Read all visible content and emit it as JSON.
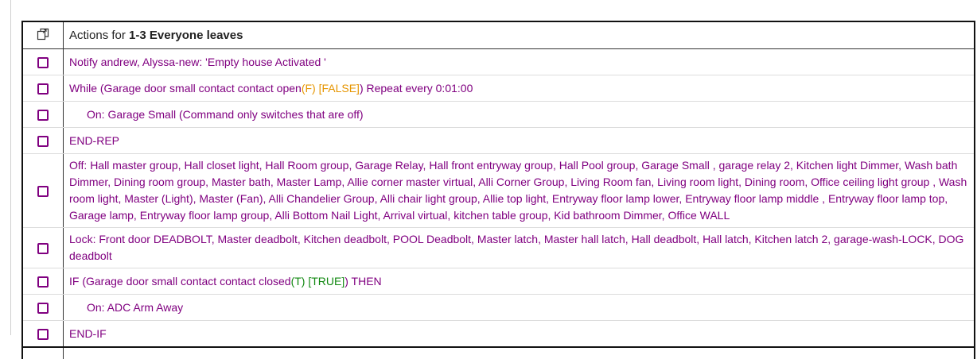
{
  "header": {
    "copy_icon": "copy-icon",
    "actions_prefix": "Actions for ",
    "rule_name": "1-3 Everyone leaves"
  },
  "rows": [
    {
      "text": "Notify andrew, Alyssa-new: 'Empty house Activated '"
    },
    {
      "text_a": "While (Garage door small contact contact open",
      "text_b": "(F) [FALSE]",
      "text_c": ") Repeat every 0:01:00"
    },
    {
      "text": "On: Garage Small  (Command only switches that are off)"
    },
    {
      "text": "END-REP"
    },
    {
      "text": "Off: Hall master group, Hall closet light, Hall Room group, Garage Relay, Hall front entryway group, Hall Pool group, Garage Small , garage relay 2, Kitchen light Dimmer, Wash bath Dimmer, Dining room group, Master bath, Master Lamp, Allie corner master virtual, Alli Corner Group, Living Room fan, Living room light, Dining room, Office ceiling light group , Wash room light, Master (Light), Master (Fan), Alli Chandelier Group, Alli chair light group, Allie top light, Entryway floor lamp lower, Entryway floor lamp middle , Entryway floor lamp top, Garage lamp, Entryway floor lamp group, Alli Bottom Nail Light, Arrival virtual, kitchen table group, Kid bathroom Dimmer, Office WALL"
    },
    {
      "text": "Lock: Front door DEADBOLT, Master deadbolt, Kitchen deadbolt, POOL Deadbolt, Master latch, Master hall latch, Hall deadbolt, Hall latch, Kitchen latch 2, garage-wash-LOCK, DOG deadbolt"
    },
    {
      "text_a": "IF (Garage door small contact contact closed",
      "text_b": "(T) [TRUE]",
      "text_c": ") THEN"
    },
    {
      "text": "On: ADC Arm Away"
    },
    {
      "text": "END-IF"
    }
  ],
  "colors": {
    "action_text": "#800080",
    "false_state": "#e69500",
    "true_state": "#118811"
  }
}
